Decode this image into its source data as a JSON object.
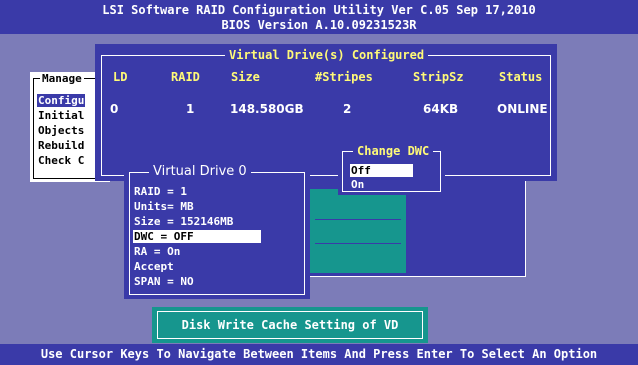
{
  "title": {
    "line1": "LSI Software RAID Configuration Utility Ver C.05 Sep 17,2010",
    "line2": "BIOS Version  A.10.09231523R"
  },
  "management_menu": {
    "title": "Manage",
    "items": [
      "Configu",
      "Initial",
      "Objects",
      "Rebuild",
      "Check C"
    ],
    "selected_index": 0
  },
  "virtual_drives": {
    "title": "Virtual Drive(s) Configured",
    "headers": [
      "LD",
      "RAID",
      "Size",
      "#Stripes",
      "StripSz",
      "Status"
    ],
    "rows": [
      [
        "0",
        "1",
        "148.580GB",
        "2",
        "64KB",
        "ONLINE"
      ]
    ]
  },
  "change_dwc": {
    "title": "Change DWC",
    "options": [
      "Off",
      "On"
    ],
    "selected_index": 0
  },
  "virtual_drive_0": {
    "title": "Virtual Drive 0",
    "items": [
      "RAID = 1",
      "Units= MB",
      "Size = 152146MB",
      "DWC  = OFF",
      "RA   = On",
      "Accept",
      "SPAN = NO"
    ],
    "selected_index": 3
  },
  "help_box": {
    "text": "Disk Write Cache Setting of VD"
  },
  "status_bar": {
    "text": "Use Cursor Keys To Navigate Between Items And Press Enter To Select An Option"
  },
  "colors": {
    "background": "#7c7cb8",
    "panel_blue": "#3a3aa8",
    "teal": "#16968e",
    "highlight_yellow": "#fffa78"
  }
}
